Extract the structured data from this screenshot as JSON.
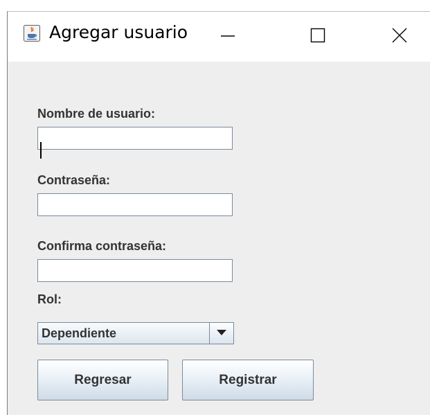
{
  "window": {
    "title": "Agregar usuario",
    "app_icon": "java-icon",
    "controls": {
      "minimize_icon": "minimize-icon",
      "maximize_icon": "maximize-icon",
      "close_icon": "close-icon"
    }
  },
  "form": {
    "username": {
      "label": "Nombre de usuario:",
      "value": ""
    },
    "password": {
      "label": "Contraseña:",
      "value": ""
    },
    "confirm_password": {
      "label": "Confirma contraseña:",
      "value": ""
    },
    "role": {
      "label": "Rol:",
      "selected": "Dependiente"
    }
  },
  "buttons": {
    "back_label": "Regresar",
    "register_label": "Registrar"
  },
  "colors": {
    "window_background": "#eeeeee",
    "titlebar_background": "#ffffff",
    "label_text": "#333333",
    "field_border": "#7a8a99"
  }
}
